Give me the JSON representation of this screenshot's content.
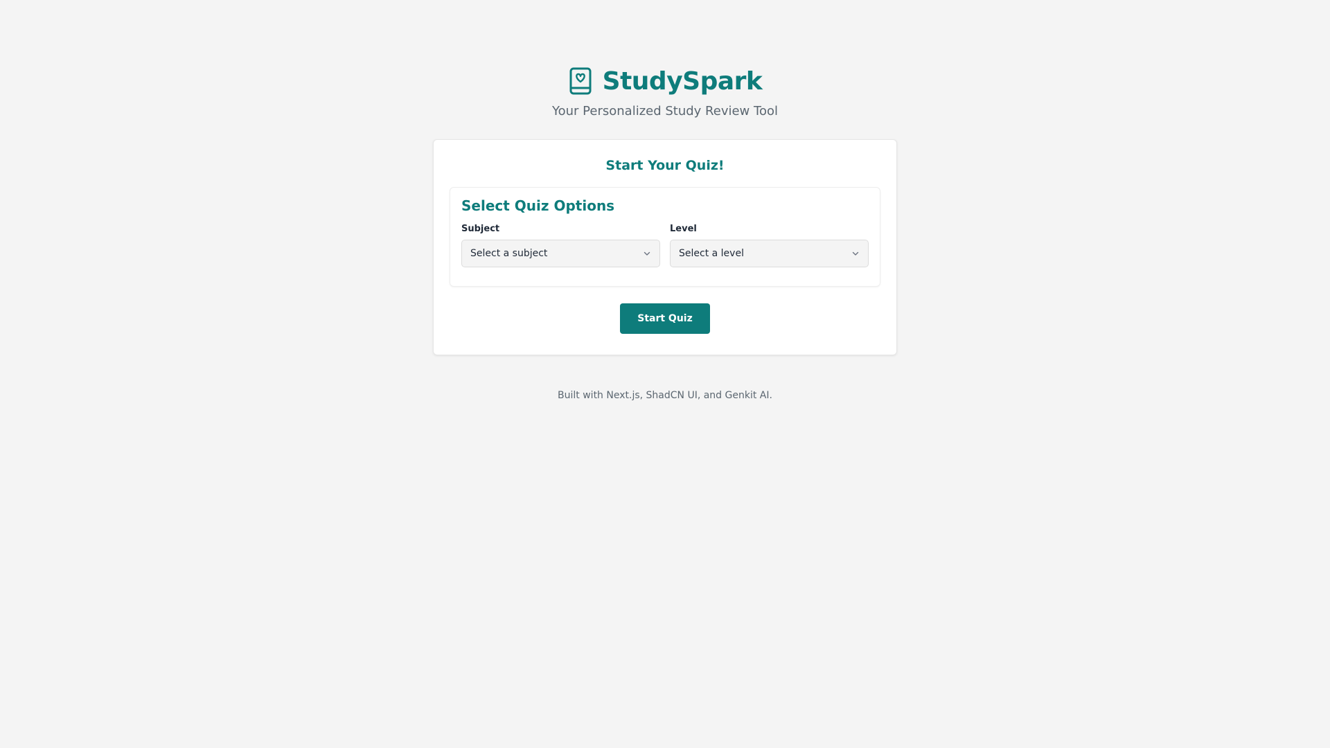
{
  "header": {
    "title": "StudySpark",
    "subtitle": "Your Personalized Study Review Tool",
    "icon": "book-heart-icon"
  },
  "card": {
    "title": "Start Your Quiz!",
    "options": {
      "title": "Select Quiz Options",
      "subject": {
        "label": "Subject",
        "placeholder": "Select a subject"
      },
      "level": {
        "label": "Level",
        "placeholder": "Select a level"
      }
    },
    "start_label": "Start Quiz"
  },
  "footer": {
    "text": "Built with Next.js, ShadCN UI, and Genkit AI."
  },
  "colors": {
    "accent": "#0e7c7b",
    "background": "#f4f4f4",
    "card": "#ffffff"
  }
}
